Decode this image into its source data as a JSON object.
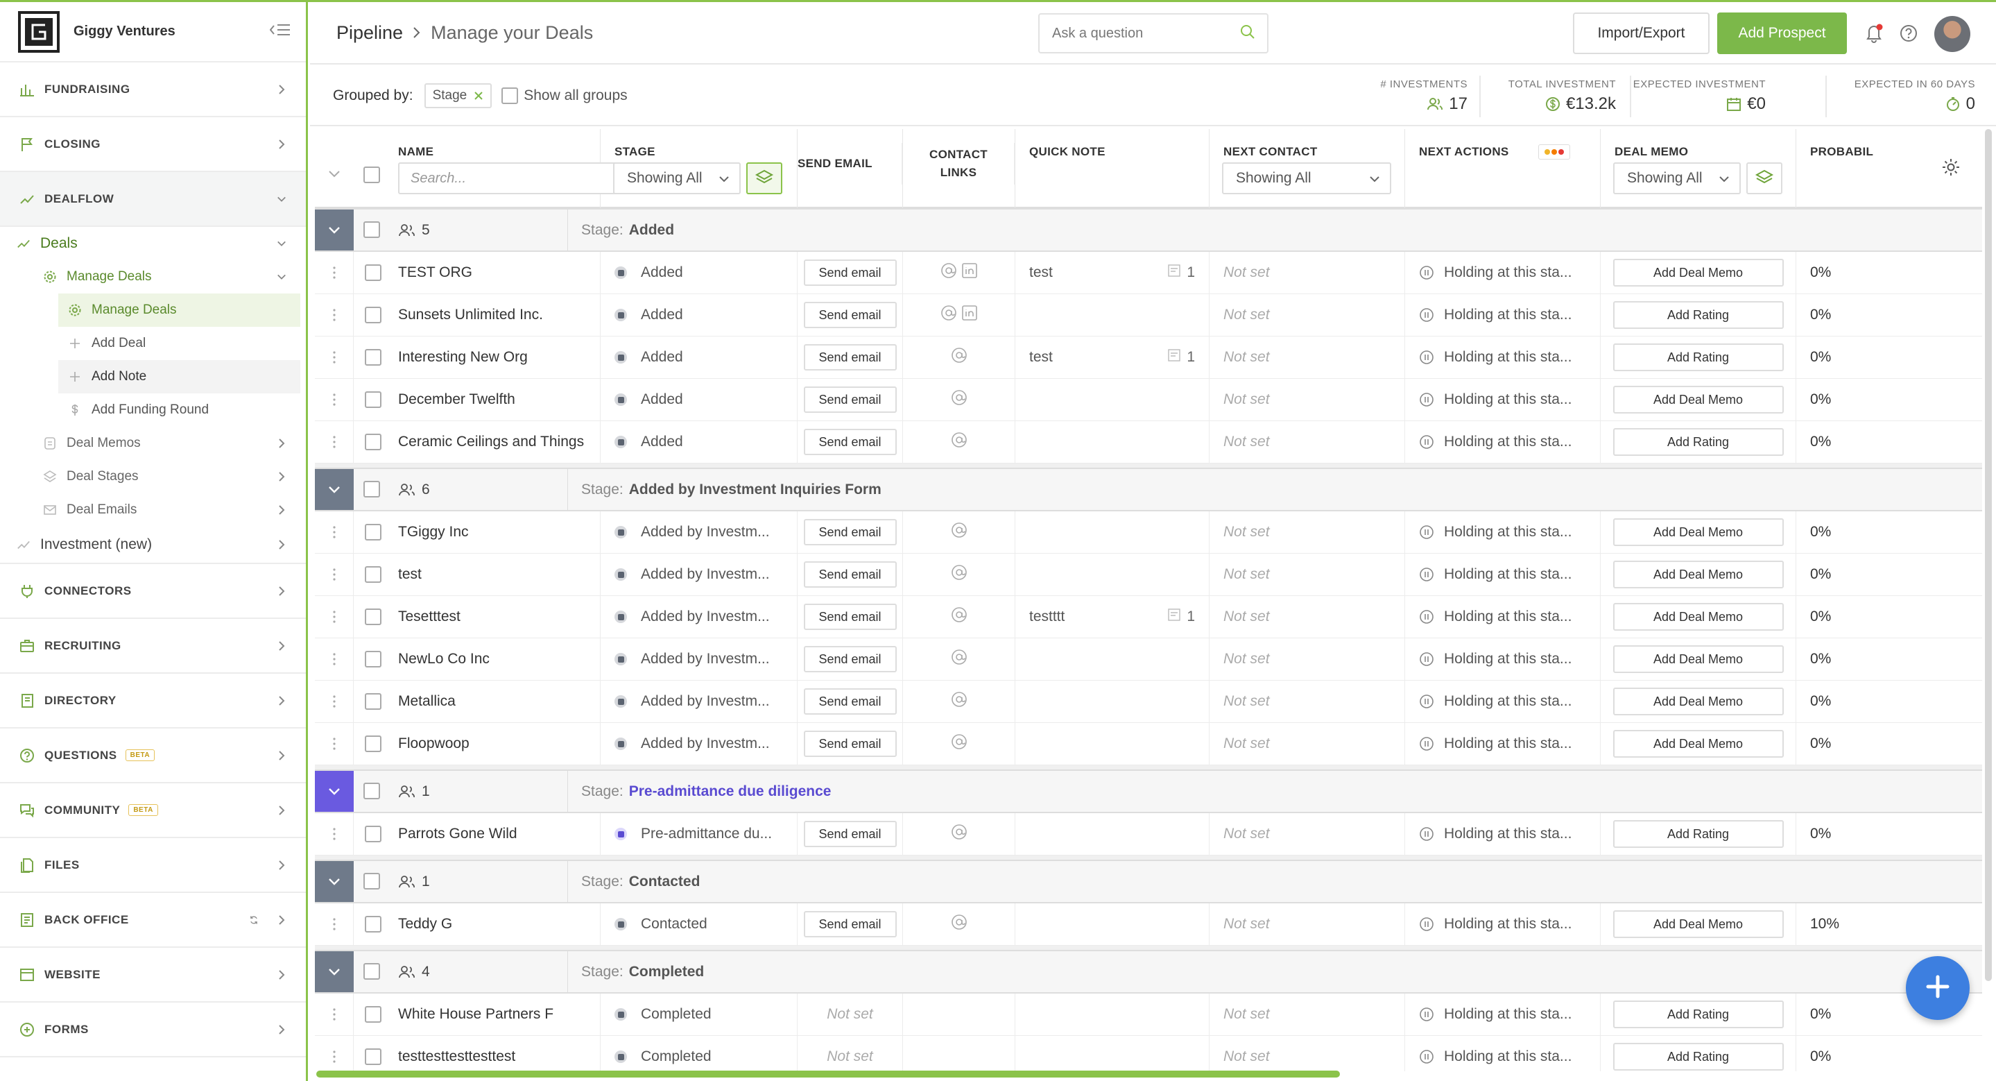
{
  "sidebar": {
    "org_name": "Giggy Ventures",
    "sections_top": [
      {
        "label": "FUNDRAISING",
        "icon": "chart-bar-icon"
      },
      {
        "label": "CLOSING",
        "icon": "flag-icon"
      },
      {
        "label": "DEALFLOW",
        "icon": "trend-icon"
      }
    ],
    "deals_label": "Deals",
    "manage_deals_label": "Manage Deals",
    "manage_items": [
      {
        "label": "Manage Deals",
        "icon": "gear-icon"
      },
      {
        "label": "Add Deal",
        "icon": "plus-icon"
      },
      {
        "label": "Add Note",
        "icon": "plus-icon"
      },
      {
        "label": "Add Funding Round",
        "icon": "dollar-icon"
      }
    ],
    "deal_subs": [
      {
        "label": "Deal Memos",
        "icon": "memo-icon"
      },
      {
        "label": "Deal Stages",
        "icon": "layers-icon"
      },
      {
        "label": "Deal Emails",
        "icon": "mail-icon"
      }
    ],
    "investment_label": "Investment (new)",
    "sections_bottom": [
      {
        "label": "CONNECTORS",
        "icon": "plug-icon",
        "badge": ""
      },
      {
        "label": "RECRUITING",
        "icon": "briefcase-icon",
        "badge": ""
      },
      {
        "label": "DIRECTORY",
        "icon": "book-icon",
        "badge": ""
      },
      {
        "label": "QUESTIONS",
        "icon": "question-icon",
        "badge": "BETA"
      },
      {
        "label": "COMMUNITY",
        "icon": "chat-icon",
        "badge": "BETA"
      },
      {
        "label": "FILES",
        "icon": "files-icon",
        "badge": ""
      },
      {
        "label": "BACK OFFICE",
        "icon": "ledger-icon",
        "badge": ""
      },
      {
        "label": "WEBSITE",
        "icon": "window-icon",
        "badge": ""
      },
      {
        "label": "FORMS",
        "icon": "form-icon",
        "badge": ""
      }
    ]
  },
  "header": {
    "breadcrumb_root": "Pipeline",
    "breadcrumb_page": "Manage your Deals",
    "search_placeholder": "Ask a question",
    "import_export": "Import/Export",
    "add_prospect": "Add Prospect"
  },
  "toolbar": {
    "grouped_by": "Grouped by:",
    "group_chip": "Stage",
    "show_all_groups": "Show all groups",
    "stats": [
      {
        "label": "# INVESTMENTS",
        "value": "17",
        "icon": "people-icon"
      },
      {
        "label": "TOTAL INVESTMENT",
        "value": "€13.2k",
        "icon": "coin-icon"
      },
      {
        "label": "EXPECTED INVESTMENT",
        "value": "€0",
        "icon": "calendar-icon"
      },
      {
        "label": "EXPECTED IN 60 DAYS",
        "value": "0",
        "icon": "timer-icon"
      }
    ]
  },
  "table": {
    "columns": {
      "name": "NAME",
      "stage": "STAGE",
      "send_email": "SEND EMAIL",
      "contact_links": "CONTACT LINKS",
      "quick_note": "QUICK NOTE",
      "next_contact": "NEXT CONTACT",
      "next_actions": "NEXT ACTIONS",
      "deal_memo": "DEAL MEMO",
      "probability": "PROBABIL"
    },
    "name_search_placeholder": "Search...",
    "stage_filter": "Showing All",
    "next_contact_filter": "Showing All",
    "deal_memo_filter": "Showing All",
    "stage_prefix": "Stage:",
    "send_email_label": "Send email",
    "not_set": "Not set",
    "next_action_text": "Holding at this sta...",
    "groups": [
      {
        "count": "5",
        "stage": "Added",
        "accent": "gray",
        "rows": [
          {
            "name": "TEST ORG",
            "stage": "Added",
            "has_email": true,
            "links": [
              "at",
              "linkedin"
            ],
            "note": "test",
            "note_count": "1",
            "memo": "Add Deal Memo",
            "prob": "0%"
          },
          {
            "name": "Sunsets Unlimited Inc.",
            "stage": "Added",
            "has_email": true,
            "links": [
              "at",
              "linkedin"
            ],
            "note": "",
            "note_count": "",
            "memo": "Add Rating",
            "prob": "0%"
          },
          {
            "name": "Interesting New Org",
            "stage": "Added",
            "has_email": true,
            "links": [
              "at"
            ],
            "note": "test",
            "note_count": "1",
            "memo": "Add Rating",
            "prob": "0%"
          },
          {
            "name": "December Twelfth",
            "stage": "Added",
            "has_email": true,
            "links": [
              "at"
            ],
            "note": "",
            "note_count": "",
            "memo": "Add Deal Memo",
            "prob": "0%"
          },
          {
            "name": "Ceramic Ceilings and Things",
            "stage": "Added",
            "has_email": true,
            "links": [
              "at"
            ],
            "note": "",
            "note_count": "",
            "memo": "Add Rating",
            "prob": "0%"
          }
        ]
      },
      {
        "count": "6",
        "stage": "Added by Investment Inquiries Form",
        "accent": "gray",
        "rows": [
          {
            "name": "TGiggy Inc",
            "stage": "Added by Investm...",
            "has_email": true,
            "links": [
              "at"
            ],
            "note": "",
            "note_count": "",
            "memo": "Add Deal Memo",
            "prob": "0%"
          },
          {
            "name": "test",
            "stage": "Added by Investm...",
            "has_email": true,
            "links": [
              "at"
            ],
            "note": "",
            "note_count": "",
            "memo": "Add Deal Memo",
            "prob": "0%"
          },
          {
            "name": "Tesetttest",
            "stage": "Added by Investm...",
            "has_email": true,
            "links": [
              "at"
            ],
            "note": "testttt",
            "note_count": "1",
            "memo": "Add Deal Memo",
            "prob": "0%"
          },
          {
            "name": "NewLo Co Inc",
            "stage": "Added by Investm...",
            "has_email": true,
            "links": [
              "at"
            ],
            "note": "",
            "note_count": "",
            "memo": "Add Deal Memo",
            "prob": "0%"
          },
          {
            "name": "Metallica",
            "stage": "Added by Investm...",
            "has_email": true,
            "links": [
              "at"
            ],
            "note": "",
            "note_count": "",
            "memo": "Add Deal Memo",
            "prob": "0%"
          },
          {
            "name": "Floopwoop",
            "stage": "Added by Investm...",
            "has_email": true,
            "links": [
              "at"
            ],
            "note": "",
            "note_count": "",
            "memo": "Add Deal Memo",
            "prob": "0%"
          }
        ]
      },
      {
        "count": "1",
        "stage": "Pre-admittance due diligence",
        "accent": "purple",
        "rows": [
          {
            "name": "Parrots Gone Wild",
            "stage": "Pre-admittance du...",
            "has_email": true,
            "links": [
              "at"
            ],
            "note": "",
            "note_count": "",
            "memo": "Add Rating",
            "prob": "0%"
          }
        ]
      },
      {
        "count": "1",
        "stage": "Contacted",
        "accent": "gray",
        "rows": [
          {
            "name": "Teddy G",
            "stage": "Contacted",
            "has_email": true,
            "links": [
              "at"
            ],
            "note": "",
            "note_count": "",
            "memo": "Add Deal Memo",
            "prob": "10%"
          }
        ]
      },
      {
        "count": "4",
        "stage": "Completed",
        "accent": "gray",
        "rows": [
          {
            "name": "White House Partners F",
            "stage": "Completed",
            "has_email": false,
            "links": [],
            "note": "",
            "note_count": "",
            "memo": "Add Rating",
            "prob": "0%"
          },
          {
            "name": "testtesttesttesttest",
            "stage": "Completed",
            "has_email": false,
            "links": [],
            "note": "",
            "note_count": "",
            "memo": "Add Rating",
            "prob": "0%"
          }
        ]
      }
    ]
  },
  "colors": {
    "brand_green": "#7cb84a",
    "accent_purple": "#5a4bd1",
    "fab_blue": "#3d7fe0",
    "group_toggle": "#6f7a8a"
  }
}
